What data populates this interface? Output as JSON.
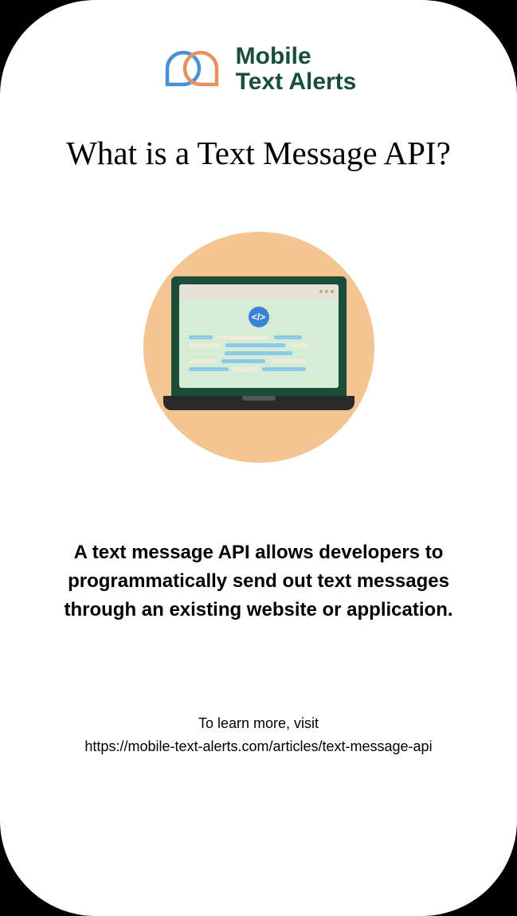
{
  "brand": {
    "name": "Mobile\nText Alerts"
  },
  "headline": "What is a Text Message API?",
  "description": "A text message API allows developers to programmatically send out text messages through an existing website or application.",
  "footer": {
    "lead": "To learn more, visit",
    "url": "https://mobile-text-alerts.com/articles/text-message-api"
  }
}
